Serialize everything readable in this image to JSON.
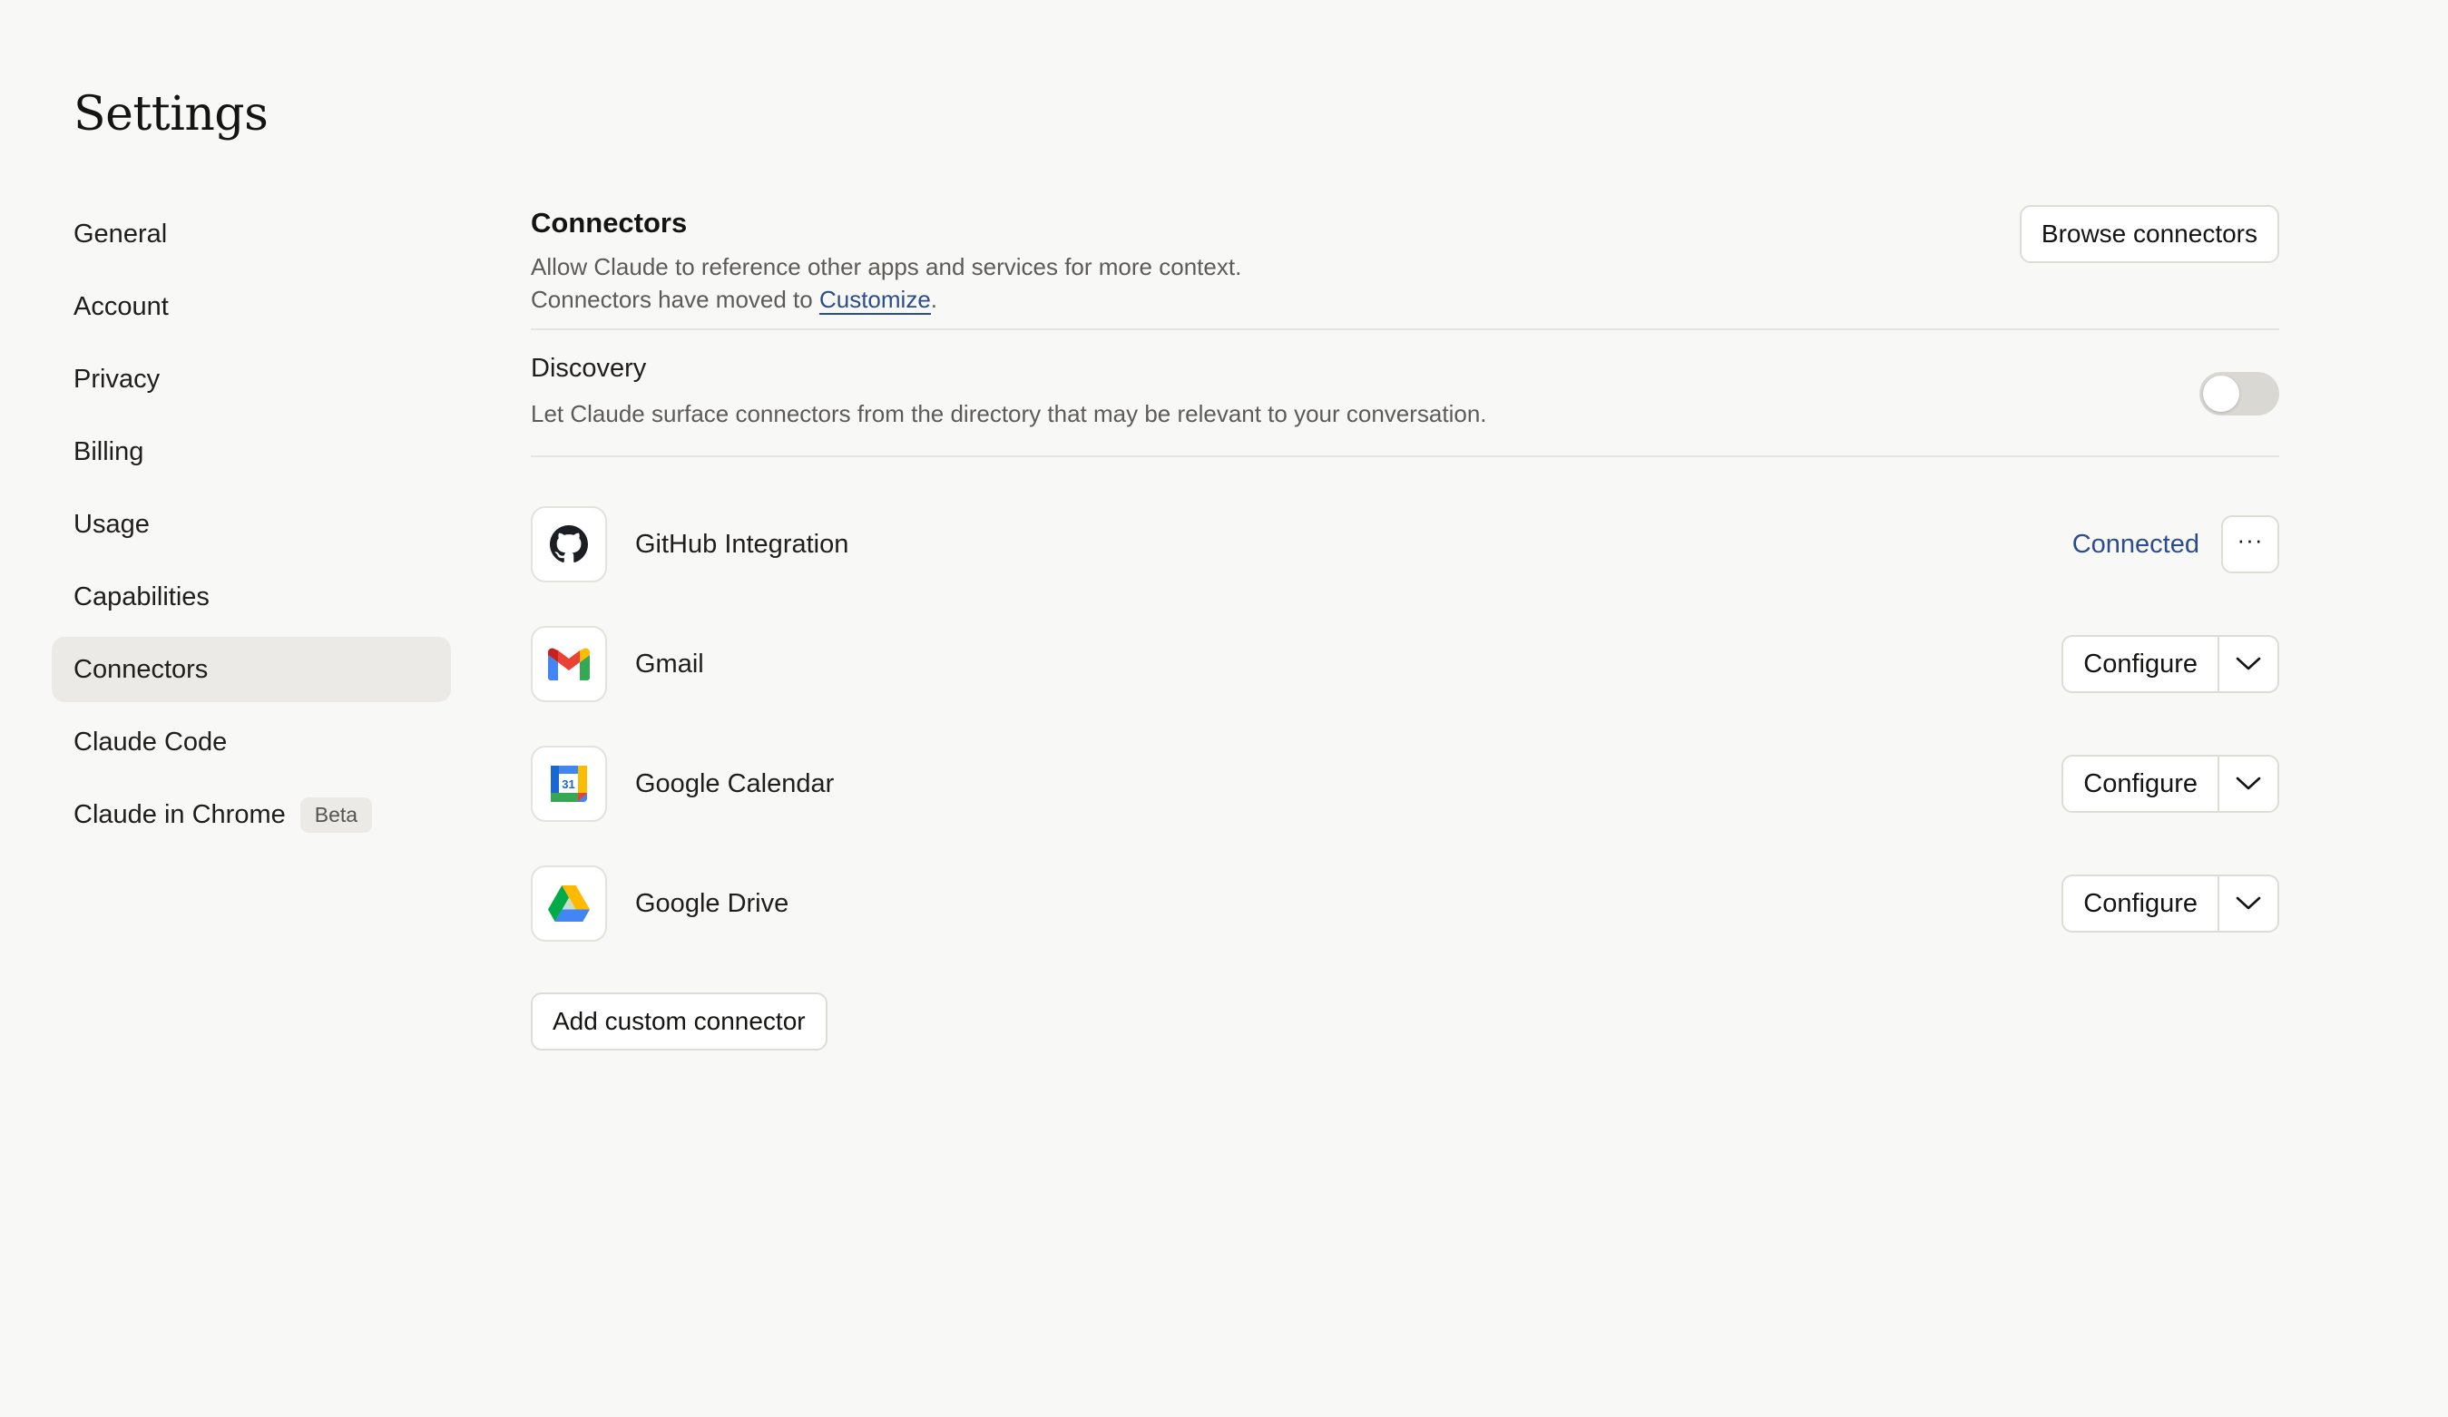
{
  "page": {
    "title": "Settings"
  },
  "sidebar": {
    "items": [
      {
        "label": "General"
      },
      {
        "label": "Account"
      },
      {
        "label": "Privacy"
      },
      {
        "label": "Billing"
      },
      {
        "label": "Usage"
      },
      {
        "label": "Capabilities"
      },
      {
        "label": "Connectors",
        "active": true
      },
      {
        "label": "Claude Code"
      },
      {
        "label": "Claude in Chrome",
        "badge": "Beta"
      }
    ]
  },
  "connectors_section": {
    "title": "Connectors",
    "description": "Allow Claude to reference other apps and services for more context.",
    "moved_prefix": "Connectors have moved to ",
    "moved_link": "Customize",
    "moved_suffix": ".",
    "browse_button": "Browse connectors"
  },
  "discovery": {
    "title": "Discovery",
    "description": "Let Claude surface connectors from the directory that may be relevant to your conversation.",
    "enabled": false
  },
  "connectors": [
    {
      "name": "GitHub Integration",
      "icon": "github-icon",
      "status": "Connected",
      "more_label": "···"
    },
    {
      "name": "Gmail",
      "icon": "gmail-icon",
      "action": "Configure"
    },
    {
      "name": "Google Calendar",
      "icon": "google-calendar-icon",
      "action": "Configure",
      "icon_text": "31"
    },
    {
      "name": "Google Drive",
      "icon": "google-drive-icon",
      "action": "Configure"
    }
  ],
  "add_custom_button": "Add custom connector",
  "colors": {
    "background": "#f8f8f6",
    "active_nav": "#ebeae6",
    "link": "#2b4d8f",
    "border": "#dddcd7"
  }
}
